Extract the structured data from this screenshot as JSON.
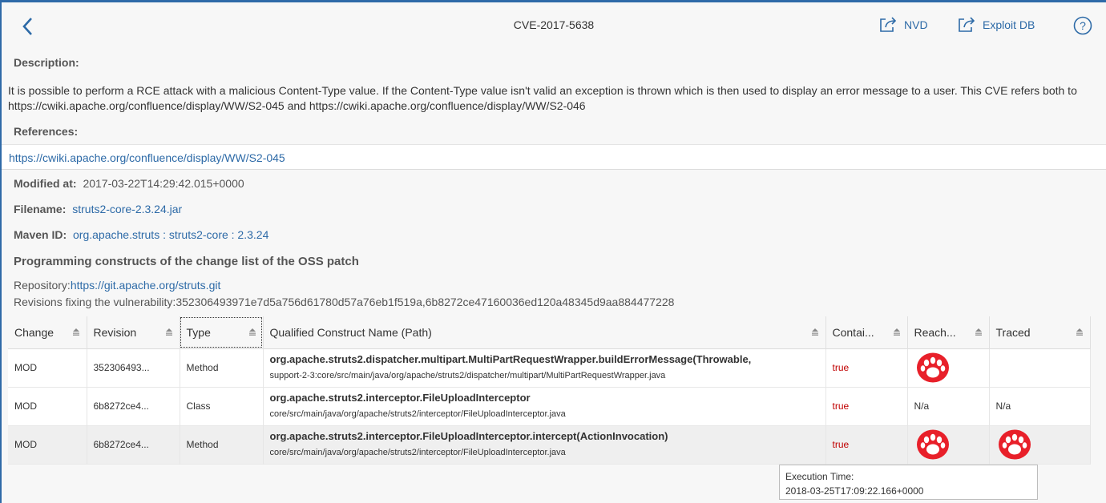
{
  "header": {
    "title": "CVE-2017-5638",
    "nvd_label": "NVD",
    "exploitdb_label": "Exploit DB"
  },
  "description": {
    "label": "Description:",
    "text": "It is possible to perform a RCE attack with a malicious Content-Type value. If the Content-Type value isn't valid an exception is thrown which is then used to display an error message to a user. This CVE refers both to https://cwiki.apache.org/confluence/display/WW/S2-045 and https://cwiki.apache.org/confluence/display/WW/S2-046"
  },
  "references": {
    "label": "References:",
    "link": "https://cwiki.apache.org/confluence/display/WW/S2-045"
  },
  "details": {
    "modified_label": "Modified at:",
    "modified_value": "2017-03-22T14:29:42.015+0000",
    "filename_label": "Filename:",
    "filename_value": "struts2-core-2.3.24.jar",
    "maven_label": "Maven ID:",
    "maven_value": "org.apache.struts : struts2-core : 2.3.24"
  },
  "patch": {
    "title": "Programming constructs of the change list of the OSS patch",
    "repo_label": "Repository:",
    "repo_link": "https://git.apache.org/struts.git",
    "revisions_text": "Revisions fixing the vulnerability:352306493971e7d5a756d61780d57a76eb1f519a,6b8272ce47160036ed120a48345d9aa884477228"
  },
  "table": {
    "columns": [
      "Change",
      "Revision",
      "Type",
      "Qualified Construct Name (Path)",
      "Contai...",
      "Reach...",
      "Traced"
    ],
    "rows": [
      {
        "change": "MOD",
        "revision": "352306493...",
        "type": "Method",
        "name": "org.apache.struts2.dispatcher.multipart.MultiPartRequestWrapper.buildErrorMessage(Throwable,",
        "path": "support-2-3:core/src/main/java/org/apache/struts2/dispatcher/multipart/MultiPartRequestWrapper.java",
        "contained": "true",
        "reach": "paw-icon",
        "traced": ""
      },
      {
        "change": "MOD",
        "revision": "6b8272ce4...",
        "type": "Class",
        "name": "org.apache.struts2.interceptor.FileUploadInterceptor",
        "path": "core/src/main/java/org/apache/struts2/interceptor/FileUploadInterceptor.java",
        "contained": "true",
        "reach": "N/a",
        "traced": "N/a"
      },
      {
        "change": "MOD",
        "revision": "6b8272ce4...",
        "type": "Method",
        "name": "org.apache.struts2.interceptor.FileUploadInterceptor.intercept(ActionInvocation)",
        "path": "core/src/main/java/org/apache/struts2/interceptor/FileUploadInterceptor.java",
        "contained": "true",
        "reach": "paw-icon",
        "traced": "paw-icon"
      }
    ]
  },
  "tooltip": {
    "label": "Execution Time:",
    "value": "2018-03-25T17:09:22.166+0000"
  },
  "colors": {
    "link": "#2d6aa7",
    "true_text": "#c00000",
    "paw_red": "#e8202a",
    "frame_blue": "#2f6aa8"
  }
}
